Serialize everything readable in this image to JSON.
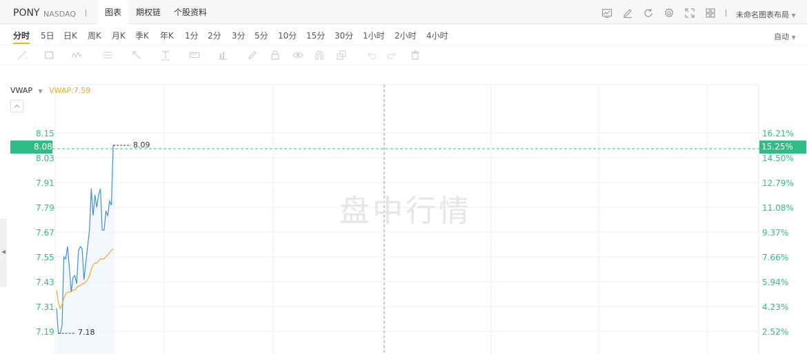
{
  "header": {
    "symbol": "PONY",
    "exchange": "NASDAQ",
    "tabs": [
      {
        "label": "图表",
        "active": true
      },
      {
        "label": "期权链",
        "active": false
      },
      {
        "label": "个股资料",
        "active": false
      }
    ],
    "layout_name": "未命名图表布局"
  },
  "intervals": {
    "items": [
      "分时",
      "5日",
      "日K",
      "周K",
      "月K",
      "季K",
      "年K",
      "1分",
      "2分",
      "3分",
      "5分",
      "10分",
      "15分",
      "30分",
      "1小时",
      "2小时",
      "4小时"
    ],
    "active": "分时",
    "scale_mode": "自动"
  },
  "chart": {
    "indicator_name": "VWAP",
    "indicator_value": "VWAP:7.59",
    "watermark": "盘中行情",
    "current_price": "8.08",
    "current_pct": "15.25%",
    "high_label": "8.09",
    "low_label": "7.18",
    "price_ticks": [
      "8.15",
      "8.03",
      "7.91",
      "7.79",
      "7.67",
      "7.55",
      "7.43",
      "7.31",
      "7.19"
    ],
    "pct_ticks": [
      "16.21%",
      "14.50%",
      "12.79%",
      "11.08%",
      "9.37%",
      "7.66%",
      "5.94%",
      "4.23%",
      "2.52%"
    ],
    "colors": {
      "price_line": "#3b8fe0",
      "vwap_line": "#f5a623",
      "up_green": "#2ebd85",
      "watermark": "#e6e6e6"
    }
  },
  "chart_data": {
    "type": "line",
    "title": "",
    "xlabel": "",
    "ylabel": "",
    "ylim": [
      7.13,
      8.21
    ],
    "series": [
      {
        "name": "",
        "values": [
          7.3,
          7.18,
          7.18,
          7.22,
          7.55,
          7.54,
          7.6,
          7.5,
          7.38,
          7.45,
          7.46,
          7.42,
          7.58,
          7.6,
          7.59,
          7.44,
          7.52,
          7.6,
          7.68,
          7.88,
          7.75,
          7.85,
          7.79,
          7.85,
          7.88,
          7.68,
          7.68,
          7.77,
          7.75,
          7.82,
          7.8,
          8.09,
          8.09
        ]
      },
      {
        "name": "VWAP",
        "values": [
          7.39,
          7.33,
          7.3,
          7.32,
          7.35,
          7.37,
          7.38,
          7.38,
          7.38,
          7.39,
          7.39,
          7.4,
          7.41,
          7.41,
          7.42,
          7.42,
          7.43,
          7.44,
          7.46,
          7.49,
          7.51,
          7.52,
          7.52,
          7.53,
          7.54,
          7.54,
          7.54,
          7.55,
          7.56,
          7.57,
          7.58,
          7.59
        ]
      }
    ]
  }
}
